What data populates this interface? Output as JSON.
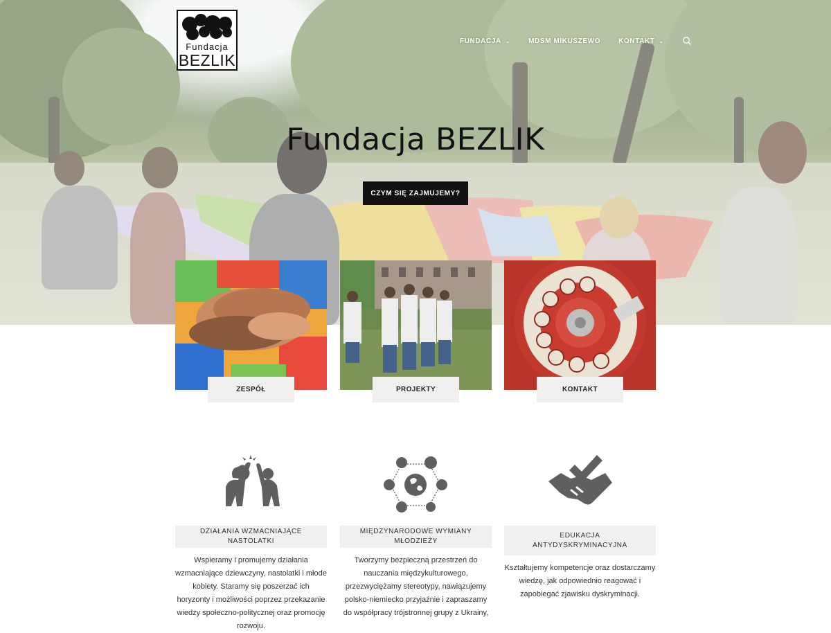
{
  "logo": {
    "line1": "Fundacja",
    "line2": "BEZLIK"
  },
  "nav": {
    "items": [
      {
        "label": "FUNDACJA",
        "has_dropdown": true
      },
      {
        "label": "MDSM MIKUSZEWO",
        "has_dropdown": false
      },
      {
        "label": "KONTAKT",
        "has_dropdown": true
      }
    ],
    "search_icon": "search-icon"
  },
  "hero": {
    "title": "Fundacja BEZLIK",
    "button": "CZYM SIĘ ZAJMUJEMY?"
  },
  "cards": [
    {
      "label": "ZESPÓŁ"
    },
    {
      "label": "PROJEKTY"
    },
    {
      "label": "KONTAKT"
    }
  ],
  "features": [
    {
      "icon": "high-five-icon",
      "title": "DZIAŁANIA WZMACNIAJĄCE NASTOLATKI",
      "text": "Wspieramy i promujemy działania wzmacniające dziewczyny, nastolatki i młode kobiety. Staramy się poszerzać ich horyzonty i możliwości poprzez przekazanie wiedzy społeczno-politycznej oraz promocję rozwoju."
    },
    {
      "icon": "global-network-icon",
      "title": "MIĘDZYNARODOWE WYMIANY MŁODZIEŻY",
      "text": "Tworzymy bezpieczną przestrzeń do nauczania międzykulturowego, przezwyciężamy stereotypy, nawiązujemy polsko-niemiecko przyjaźnie i zapraszamy do współpracy trójstronnej grupy z Ukrainy,"
    },
    {
      "icon": "handshake-check-icon",
      "title": "EDUKACJA ANTYDYSKRYMINACYJNA",
      "text": "Kształtujemy kompetencje oraz dostarczamy wiedzę, jak odpowiednio reagować i zapobiegać zjawisku dyskryminacji."
    }
  ],
  "colors": {
    "accent": "#111111",
    "label_bg": "#f1f0ee",
    "icon_gray": "#5f5f5f"
  }
}
